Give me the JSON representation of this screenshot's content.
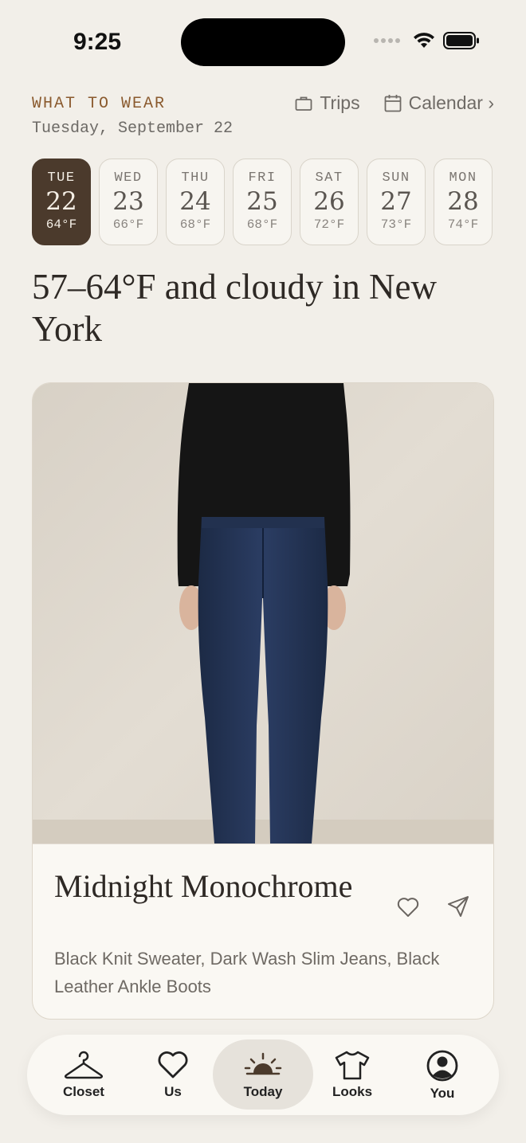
{
  "status_bar": {
    "time": "9:25"
  },
  "header": {
    "kicker": "WHAT TO WEAR",
    "date": "Tuesday, September 22",
    "trips_label": "Trips",
    "calendar_label": "Calendar ›"
  },
  "days": [
    {
      "name": "TUE",
      "num": "22",
      "temp": "64°F",
      "active": true
    },
    {
      "name": "WED",
      "num": "23",
      "temp": "66°F"
    },
    {
      "name": "THU",
      "num": "24",
      "temp": "68°F"
    },
    {
      "name": "FRI",
      "num": "25",
      "temp": "68°F"
    },
    {
      "name": "SAT",
      "num": "26",
      "temp": "72°F"
    },
    {
      "name": "SUN",
      "num": "27",
      "temp": "73°F"
    },
    {
      "name": "MON",
      "num": "28",
      "temp": "74°F"
    }
  ],
  "weather_headline": "57–64°F and cloudy in New York",
  "outfit": {
    "name": "Midnight Monochrome",
    "items": "Black Knit Sweater, Dark Wash Slim Jeans, Black Leather Ankle Boots"
  },
  "tabs": [
    {
      "label": "Closet",
      "icon": "hanger-icon"
    },
    {
      "label": "Us",
      "icon": "heart-icon"
    },
    {
      "label": "Today",
      "icon": "sunrise-icon",
      "active": true
    },
    {
      "label": "Looks",
      "icon": "tshirt-icon"
    },
    {
      "label": "You",
      "icon": "profile-icon"
    }
  ],
  "colors": {
    "background": "#f2efe9",
    "accent_brown": "#4b3a2c",
    "kicker": "#8a5a2e"
  }
}
